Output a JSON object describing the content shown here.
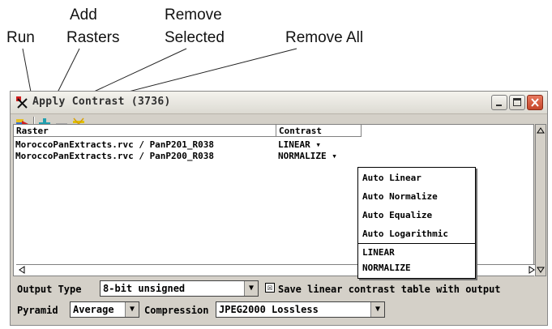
{
  "callouts": {
    "run": "Run",
    "add_rasters_line1": "Add",
    "add_rasters_line2": "Rasters",
    "remove_selected_line1": "Remove",
    "remove_selected_line2": "Selected",
    "remove_all": "Remove All"
  },
  "window": {
    "title": "Apply Contrast (3736)"
  },
  "toolbar": {
    "icons": [
      "run-icon",
      "add-rasters-icon",
      "remove-selected-icon",
      "remove-all-icon"
    ]
  },
  "table": {
    "headers": [
      "Raster",
      "Contrast"
    ],
    "rows": [
      {
        "raster": "MoroccoPanExtracts.rvc / PanP201_R038",
        "contrast": "LINEAR ▾"
      },
      {
        "raster": "MoroccoPanExtracts.rvc / PanP200_R038",
        "contrast": "NORMALIZE ▾"
      }
    ]
  },
  "dropdown_menu": {
    "items": [
      "Auto Linear",
      "Auto Normalize",
      "Auto Equalize",
      "Auto Logarithmic",
      "LINEAR",
      "NORMALIZE"
    ]
  },
  "options": {
    "output_type_label": "Output Type",
    "output_type_value": "8-bit unsigned",
    "save_table_label": "Save linear contrast table with output",
    "save_table_checked": "☒",
    "pyramid_label": "Pyramid",
    "pyramid_value": "Average",
    "compression_label": "Compression",
    "compression_value": "JPEG2000 Lossless"
  }
}
